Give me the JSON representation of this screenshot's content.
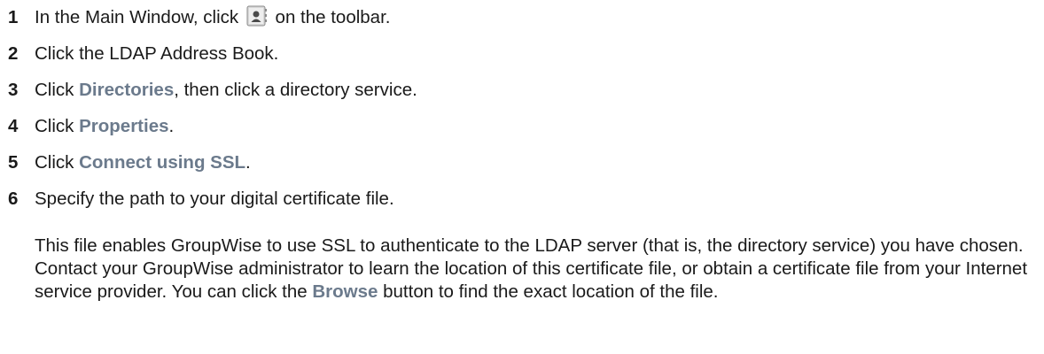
{
  "steps": [
    {
      "num": "1",
      "before": "In the Main Window, click ",
      "icon": "address-book-icon",
      "after": " on the toolbar."
    },
    {
      "num": "2",
      "text": "Click the LDAP Address Book."
    },
    {
      "num": "3",
      "before": "Click ",
      "ui": "Directories",
      "after": ", then click a directory service."
    },
    {
      "num": "4",
      "before": "Click ",
      "ui": "Properties",
      "after": "."
    },
    {
      "num": "5",
      "before": "Click ",
      "ui": "Connect using SSL",
      "after": "."
    },
    {
      "num": "6",
      "text": "Specify the path to your digital certificate file."
    }
  ],
  "note": {
    "before": "This file enables GroupWise to use SSL to authenticate to the LDAP server (that is, the directory service) you have chosen. Contact your GroupWise administrator to learn the location of this certificate file, or obtain a certificate file from your Internet service provider. You can click the ",
    "ui": "Browse",
    "after": " button to find the exact location of the file."
  },
  "colors": {
    "ui_text": "#6b7a8c",
    "body_text": "#1a1a1a"
  }
}
